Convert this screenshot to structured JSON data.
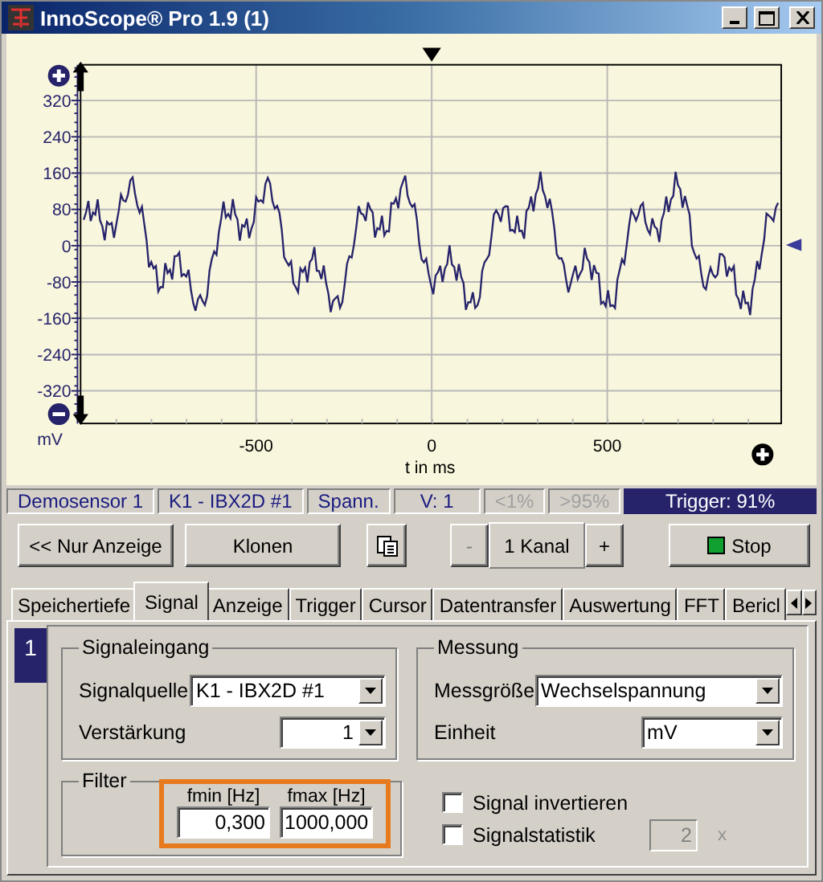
{
  "window": {
    "title": "InnoScope® Pro 1.9 (1)"
  },
  "plot": {
    "y_unit": "mV",
    "xlabel": "t in ms",
    "yticks": [
      "320",
      "240",
      "160",
      "80",
      "0",
      "-80",
      "-160",
      "-240",
      "-320"
    ],
    "xticks": [
      "-500",
      "0",
      "500"
    ]
  },
  "status_bar": [
    {
      "text": "Demosensor 1",
      "disabled": false
    },
    {
      "text": "K1 - IBX2D #1",
      "disabled": false
    },
    {
      "text": "Spann.",
      "disabled": false
    },
    {
      "text": "V: 1",
      "disabled": false
    },
    {
      "text": "<1%",
      "disabled": true
    },
    {
      "text": ">95%",
      "disabled": true
    }
  ],
  "trigger": "Trigger: 91%",
  "toolbar": {
    "display_only": "<< Nur Anzeige",
    "clone": "Klonen",
    "minus": "-",
    "channels": "1 Kanal",
    "plus": "+",
    "stop": "Stop"
  },
  "tabs": [
    {
      "label": "Speichertiefe",
      "selected": false
    },
    {
      "label": "Signal",
      "selected": true
    },
    {
      "label": "Anzeige",
      "selected": false
    },
    {
      "label": "Trigger",
      "selected": false
    },
    {
      "label": "Cursor",
      "selected": false
    },
    {
      "label": "Datentransfer",
      "selected": false
    },
    {
      "label": "Auswertung",
      "selected": false
    },
    {
      "label": "FFT",
      "selected": false
    },
    {
      "label": "Bericl",
      "selected": false
    }
  ],
  "channel_number": "1",
  "signal_input": {
    "title": "Signaleingang",
    "source_label": "Signalquelle",
    "source_value": "K1 - IBX2D #1",
    "gain_label": "Verstärkung",
    "gain_value": "1"
  },
  "measurement": {
    "title": "Messung",
    "quantity_label": "Messgröße",
    "quantity_value": "Wechselspannung",
    "unit_label": "Einheit",
    "unit_value": "mV"
  },
  "filter": {
    "title": "Filter",
    "fields": [
      {
        "label": "fmin [Hz]",
        "value": "0,300"
      },
      {
        "label": "fmax [Hz]",
        "value": "1000,000"
      }
    ]
  },
  "options": [
    {
      "label": "Signal invertieren",
      "checked": false
    },
    {
      "label": "Signalstatistik",
      "checked": false
    }
  ],
  "statistics": {
    "value": "2",
    "unit": "x",
    "disabled": true
  }
}
